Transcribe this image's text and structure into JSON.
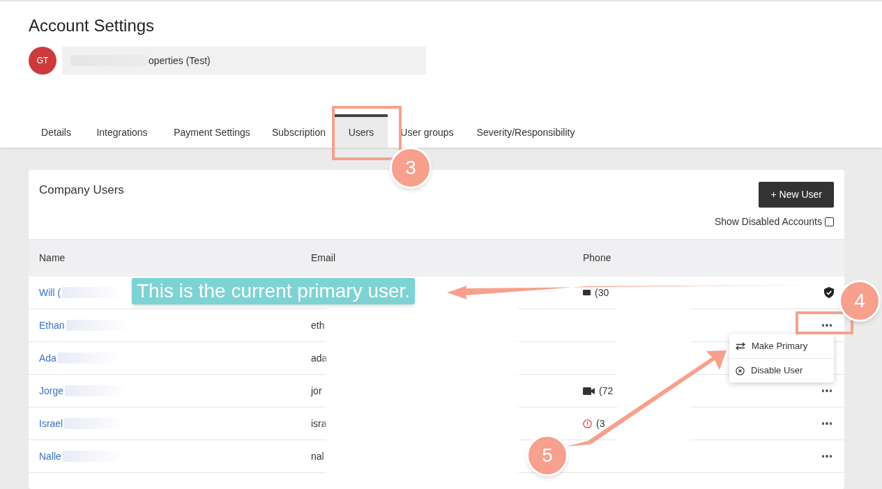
{
  "page": {
    "title": "Account Settings"
  },
  "account": {
    "initials": "GT",
    "name": "operties (Test)"
  },
  "tabs": [
    {
      "label": "Details",
      "selected": false
    },
    {
      "label": "Integrations",
      "selected": false
    },
    {
      "label": "Payment Settings",
      "selected": false
    },
    {
      "label": "Subscription",
      "selected": false
    },
    {
      "label": "Users",
      "selected": true
    },
    {
      "label": "User groups",
      "selected": false
    },
    {
      "label": "Severity/Responsibility",
      "selected": false
    }
  ],
  "users_card": {
    "title": "Company Users",
    "new_button": "+ New User",
    "show_disabled": {
      "label": "Show Disabled Accounts",
      "checked": false
    }
  },
  "table": {
    "columns": [
      "Name",
      "Email",
      "Phone"
    ],
    "rows": [
      {
        "name": "Will (",
        "phone": "(30",
        "kind": "device",
        "primary": true,
        "menu": false
      },
      {
        "name": "Ethan",
        "email": "eth",
        "kind": "plain",
        "primary": false,
        "menu": true
      },
      {
        "name": "Ada",
        "email": "ada",
        "kind": "plain"
      },
      {
        "name": "Jorge",
        "email": "jor",
        "phone": "(72",
        "kind": "video",
        "primary": false,
        "menu": true
      },
      {
        "name": "Israel",
        "email": "isra",
        "phone": "(3",
        "kind": "alert",
        "primary": false,
        "menu": true
      },
      {
        "name": "Nalle",
        "email": "nal",
        "kind": "plain",
        "primary": false,
        "menu": true
      }
    ]
  },
  "row_menu": {
    "items": [
      {
        "label": "Make Primary",
        "kind": "swap"
      },
      {
        "label": "Disable User",
        "kind": "disable"
      }
    ]
  },
  "annotations": {
    "caption": "This is the current primary user.",
    "steps": [
      "3",
      "4",
      "5"
    ]
  }
}
